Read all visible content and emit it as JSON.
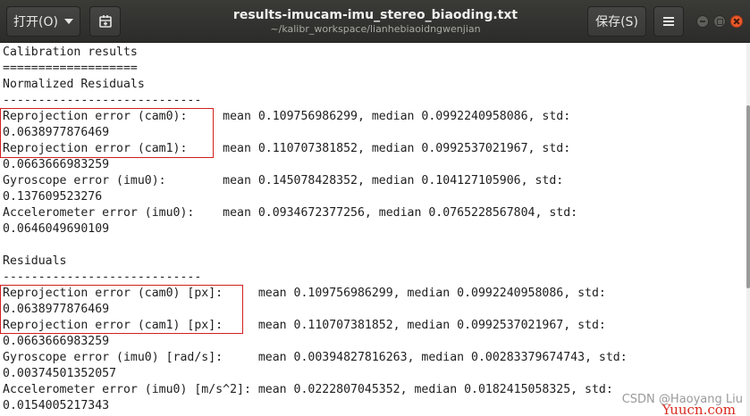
{
  "window": {
    "title": "results-imucam-imu_stereo_biaoding.txt",
    "subtitle": "~/kalibr_workspace/lianhebiaoidngwenjian"
  },
  "toolbar": {
    "open_label": "打开(O)",
    "open_icon": "chevron-down-icon",
    "new_doc_icon": "new-document-icon",
    "save_label": "保存(S)",
    "menu_icon": "hamburger-menu-icon"
  },
  "window_controls": [
    "minimize-icon",
    "maximize-icon",
    "close-icon"
  ],
  "content": {
    "lines": [
      "Calibration results",
      "===================",
      "Normalized Residuals",
      "----------------------------",
      "Reprojection error (cam0):     mean 0.109756986299, median 0.0992240958086, std:",
      "0.0638977876469",
      "Reprojection error (cam1):     mean 0.110707381852, median 0.0992537021967, std:",
      "0.0663666983259",
      "Gyroscope error (imu0):        mean 0.145078428352, median 0.104127105906, std:",
      "0.137609523276",
      "Accelerometer error (imu0):    mean 0.0934672377256, median 0.0765228567804, std:",
      "0.0646049690109",
      "",
      "Residuals",
      "----------------------------",
      "Reprojection error (cam0) [px]:     mean 0.109756986299, median 0.0992240958086, std:",
      "0.0638977876469",
      "Reprojection error (cam1) [px]:     mean 0.110707381852, median 0.0992537021967, std:",
      "0.0663666983259",
      "Gyroscope error (imu0) [rad/s]:     mean 0.00394827816263, median 0.00283379674743, std:",
      "0.00374501352057",
      "Accelerometer error (imu0) [m/s^2]: mean 0.0222807045352, median 0.0182415058325, std:",
      "0.0154005217343"
    ]
  },
  "colors": {
    "headerbar": "#2c2c2a",
    "highlight_box": "#d2201f",
    "close_button": "#e9592b"
  },
  "watermarks": {
    "yuucn": "Yuucn.com",
    "csdn": "CSDN @Haoyang Liu"
  }
}
